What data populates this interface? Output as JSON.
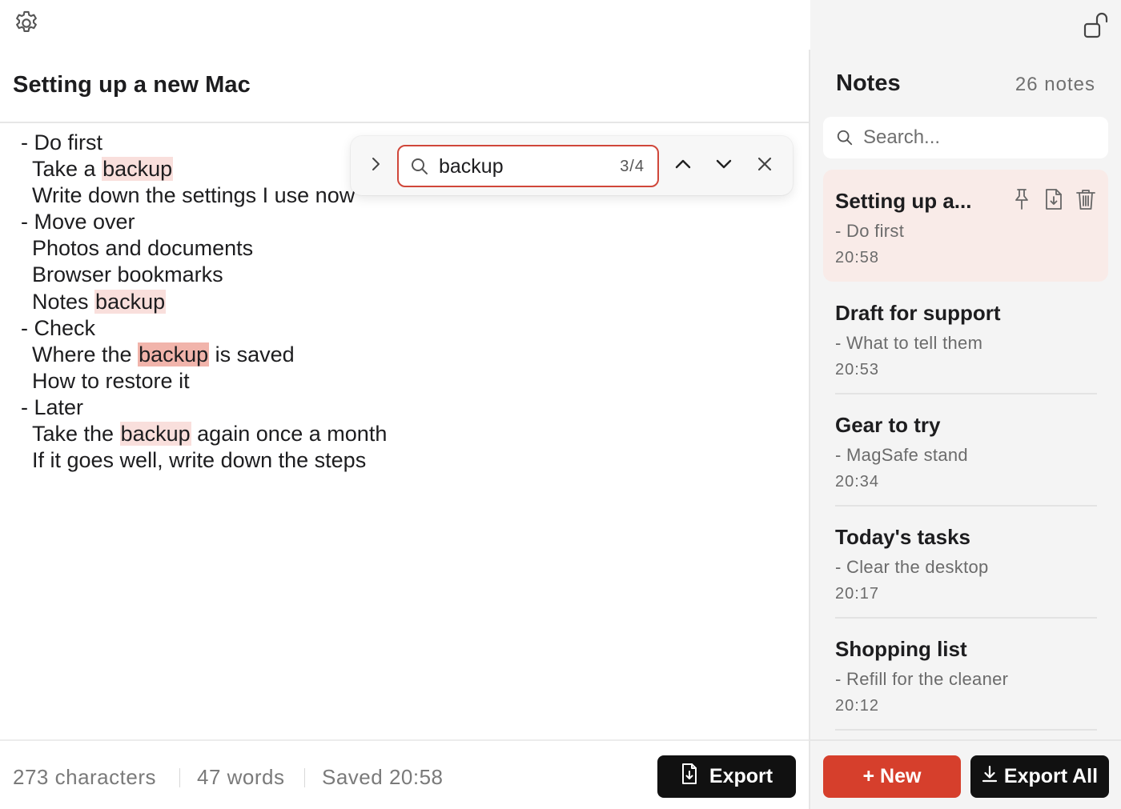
{
  "editor": {
    "settings_icon": "gear-icon",
    "title": "Setting up a new Mac",
    "lines": {
      "l1": "- Do first",
      "l2_pre": "Take a ",
      "l2_hl": "backup",
      "l3": "Write down the settings I use now",
      "l4": "- Move over",
      "l5": "Photos and documents",
      "l6": "Browser bookmarks",
      "l7_pre": "Notes ",
      "l7_hl": "backup",
      "l8": "- Check",
      "l9_pre": "Where the ",
      "l9_hl": "backup",
      "l9_post": " is saved",
      "l10": "How to restore it",
      "l11": "- Later",
      "l12_pre": "Take the ",
      "l12_hl": "backup",
      "l12_post": " again once a month",
      "l13": "If it goes well, write down the steps"
    },
    "find": {
      "query": "backup",
      "count": "3/4",
      "expand_icon": "chevron-right-icon",
      "prev_icon": "chevron-up-icon",
      "next_icon": "chevron-down-icon",
      "close_icon": "close-icon",
      "highlight_color": "#f9dfdc",
      "current_highlight_color": "#f1b4ab",
      "field_border_color": "#d0473a"
    },
    "footer": {
      "characters": "273 characters",
      "words": "47 words",
      "saved": "Saved 20:58",
      "export_label": "Export"
    }
  },
  "sidebar": {
    "lock_icon": "unlock-icon",
    "title": "Notes",
    "count": "26 notes",
    "search_placeholder": "Search...",
    "notes": [
      {
        "title": "Setting up a...",
        "snippet": "- Do first",
        "time": "20:58",
        "active": true
      },
      {
        "title": "Draft for support",
        "snippet": "- What to tell them",
        "time": "20:53"
      },
      {
        "title": "Gear to try",
        "snippet": "- MagSafe stand",
        "time": "20:34"
      },
      {
        "title": "Today's tasks",
        "snippet": "- Clear the desktop",
        "time": "20:17"
      },
      {
        "title": "Shopping list",
        "snippet": "- Refill for the cleaner",
        "time": "20:12"
      }
    ],
    "new_label": "+ New",
    "export_all_label": "Export All",
    "accent_color": "#d63f2c",
    "active_item_color": "#f9ebe8"
  }
}
